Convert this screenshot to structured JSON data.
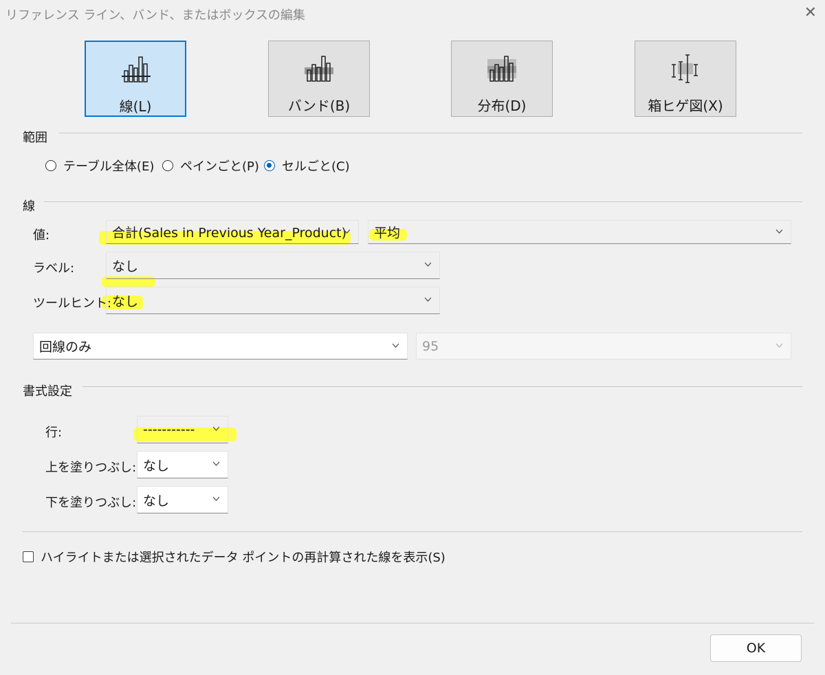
{
  "window": {
    "title": "リファレンス ライン、バンド、またはボックスの編集"
  },
  "types": [
    {
      "label": "線(L)",
      "selected": true
    },
    {
      "label": "バンド(B)",
      "selected": false
    },
    {
      "label": "分布(D)",
      "selected": false
    },
    {
      "label": "箱ヒゲ図(X)",
      "selected": false
    }
  ],
  "scope": {
    "heading": "範囲",
    "options": [
      {
        "label": "テーブル全体(E)",
        "selected": false
      },
      {
        "label": "ペインごと(P)",
        "selected": false
      },
      {
        "label": "セルごと(C)",
        "selected": true
      }
    ]
  },
  "line": {
    "heading": "線",
    "value_label": "値:",
    "value_field": "合計(Sales in Previous Year_Product)",
    "aggregation": "平均",
    "label_label": "ラベル:",
    "label_value": "なし",
    "tooltip_label": "ツールヒント:",
    "tooltip_value": "なし",
    "line_mode": "回線のみ",
    "confidence": "95"
  },
  "format": {
    "heading": "書式設定",
    "row_label": "行:",
    "row_value": "-----------",
    "fill_above_label": "上を塗りつぶし:",
    "fill_above_value": "なし",
    "fill_below_label": "下を塗りつぶし:",
    "fill_below_value": "なし"
  },
  "recalc_checkbox": {
    "label": "ハイライトまたは選択されたデータ ポイントの再計算された線を表示(S)",
    "checked": false
  },
  "ok_label": "OK",
  "colors": {
    "highlight": "#ffff33",
    "accent": "#0078d4",
    "selected_bg": "#cce4f7"
  }
}
